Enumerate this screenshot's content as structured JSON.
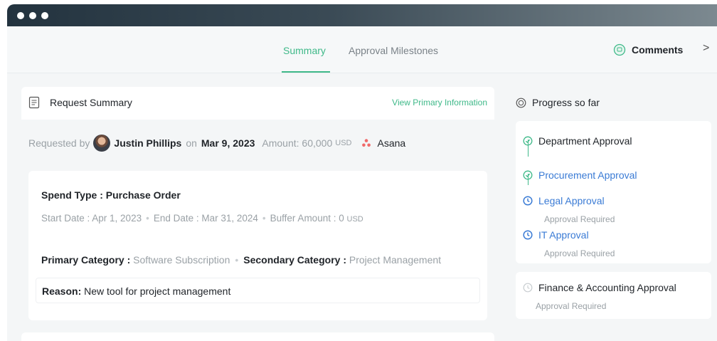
{
  "tabs": {
    "summary": "Summary",
    "milestones": "Approval Milestones"
  },
  "comments": {
    "label": "Comments",
    "chevron": ">"
  },
  "request_summary": {
    "title": "Request Summary",
    "link": "View Primary Information",
    "requested_by_label": "Requested by",
    "requester": "Justin Phillips",
    "on_label": "on",
    "date": "Mar 9, 2023",
    "amount_label": "Amount: 60,000",
    "currency": "USD",
    "vendor": "Asana"
  },
  "details": {
    "spend_type": "Spend Type : Purchase Order",
    "start_date": "Start Date : Apr 1, 2023",
    "end_date": "End Date : Mar 31, 2024",
    "buffer_amount": "Buffer Amount : 0",
    "buffer_currency": "USD",
    "primary_category_label": "Primary Category :",
    "primary_category_value": "Software Subscription",
    "secondary_category_label": "Secondary Category :",
    "secondary_category_value": "Project Management",
    "reason_label": "Reason:",
    "reason_value": "New tool for project management"
  },
  "progress": {
    "title": "Progress so far",
    "steps": [
      {
        "label": "Department Approval",
        "status": "done"
      },
      {
        "label": "Procurement Approval",
        "status": "done"
      },
      {
        "label": "Legal Approval",
        "status": "pending",
        "sub": "Approval Required"
      },
      {
        "label": "IT Approval",
        "status": "pending",
        "sub": "Approval Required"
      },
      {
        "label": "Finance & Accounting Approval",
        "status": "waiting",
        "sub": "Approval Required"
      }
    ]
  },
  "colors": {
    "accent_green": "#3fb989",
    "link_blue": "#3a7bd5",
    "muted_gray": "#9aa1a6",
    "asana_red": "#f06a6a"
  }
}
